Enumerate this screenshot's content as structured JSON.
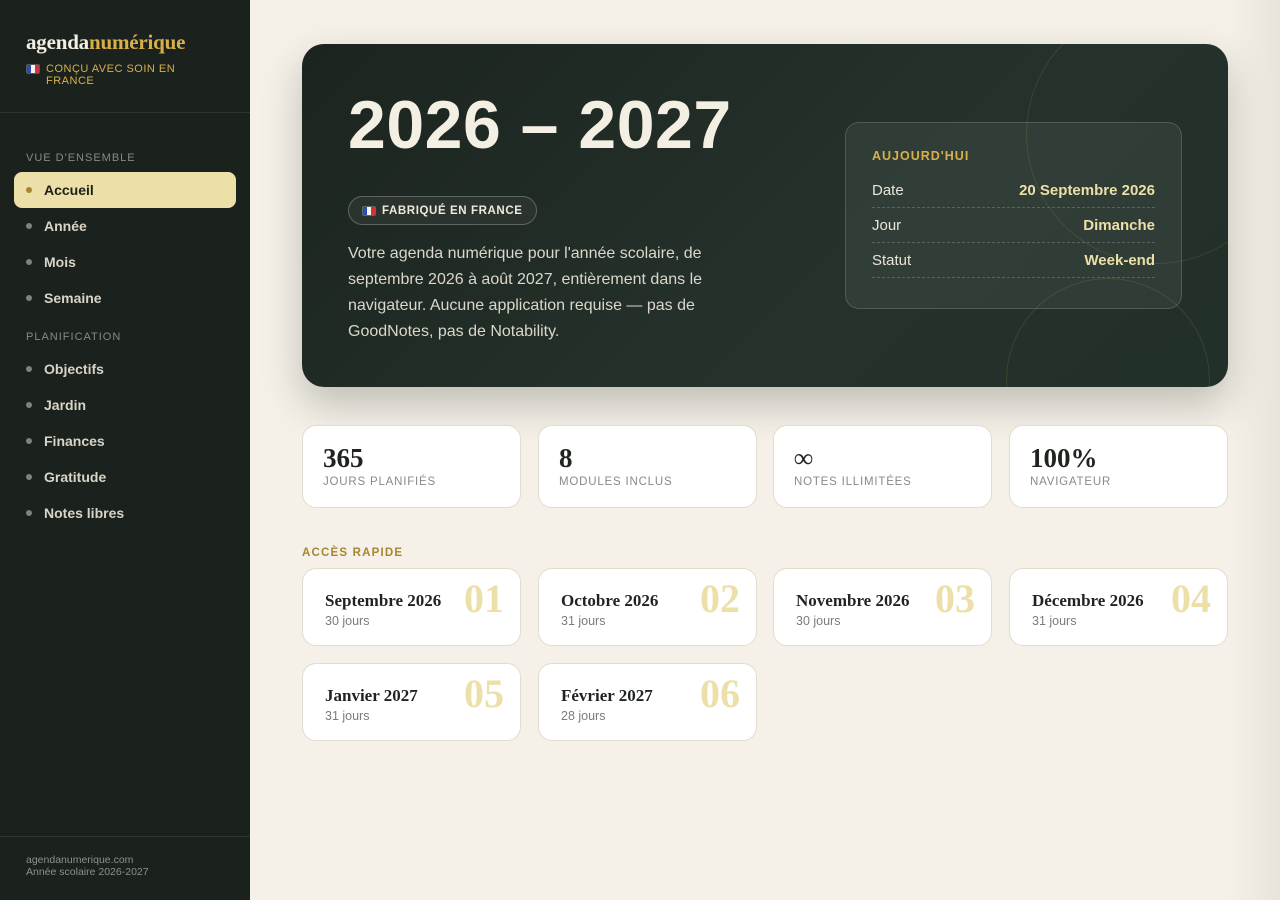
{
  "sidebar": {
    "brand_main": "agenda",
    "brand_accent": "numérique",
    "brand_tagline": "CONÇU AVEC SOIN EN FRANCE",
    "section_overview": "VUE D'ENSEMBLE",
    "section_planning": "PLANIFICATION",
    "items": [
      {
        "label": "Accueil",
        "active": true
      },
      {
        "label": "Année"
      },
      {
        "label": "Mois"
      },
      {
        "label": "Semaine"
      },
      {
        "label": "Objectifs"
      },
      {
        "label": "Jardin"
      },
      {
        "label": "Finances"
      },
      {
        "label": "Gratitude"
      },
      {
        "label": "Notes libres"
      }
    ],
    "footer_site": "agendanumerique.com",
    "footer_year": "Année scolaire 2026-2027"
  },
  "hero": {
    "title": "2026 – 2027",
    "badge": "FABRIQUÉ EN FRANCE",
    "description": "Votre agenda numérique pour l'année scolaire, de septembre 2026 à août 2027, entièrement dans le navigateur. Aucune application requise — pas de GoodNotes, pas de Notability."
  },
  "today": {
    "label": "AUJOURD'HUI",
    "rows": [
      {
        "key": "Date",
        "value": "20 Septembre 2026"
      },
      {
        "key": "Jour",
        "value": "Dimanche"
      },
      {
        "key": "Statut",
        "value": "Week-end"
      }
    ]
  },
  "stats": [
    {
      "value": "365",
      "label": "JOURS PLANIFIÉS"
    },
    {
      "value": "8",
      "label": "MODULES INCLUS"
    },
    {
      "value": "∞",
      "label": "NOTES ILLIMITÉES"
    },
    {
      "value": "100%",
      "label": "NAVIGATEUR"
    }
  ],
  "quick_access": {
    "title": "ACCÈS RAPIDE",
    "months": [
      {
        "name": "Septembre 2026",
        "days": "30 jours",
        "num": "01"
      },
      {
        "name": "Octobre 2026",
        "days": "31 jours",
        "num": "02"
      },
      {
        "name": "Novembre 2026",
        "days": "30 jours",
        "num": "03"
      },
      {
        "name": "Décembre 2026",
        "days": "31 jours",
        "num": "04"
      },
      {
        "name": "Janvier 2027",
        "days": "31 jours",
        "num": "05"
      },
      {
        "name": "Février 2027",
        "days": "28 jours",
        "num": "06"
      }
    ]
  },
  "colors": {
    "sidebar_bg": "#1b211d",
    "accent_gold": "#d8b04a",
    "active_bg": "#ecdfa8",
    "page_bg": "#f5f1e8"
  }
}
